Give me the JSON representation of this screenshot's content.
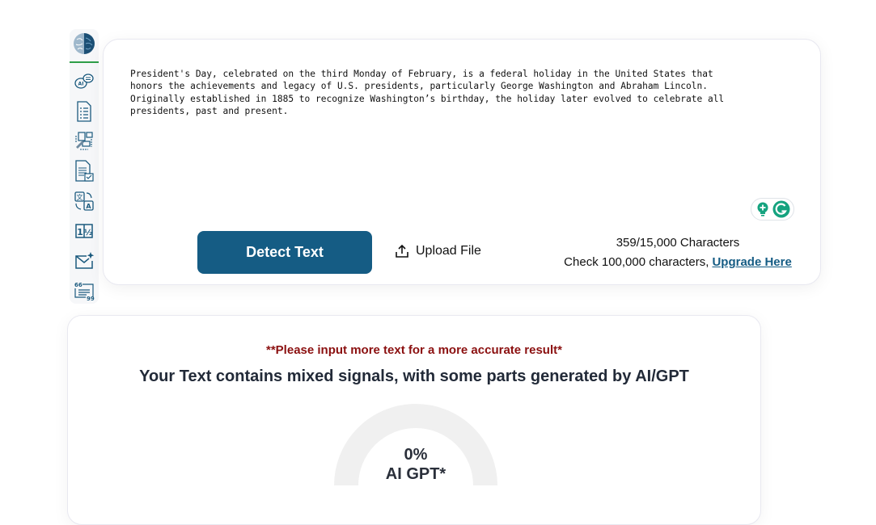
{
  "sidebar": {
    "logo": "brain-logo-icon",
    "items": [
      {
        "name": "ai-chat",
        "icon": "ai-chat-bubbles-icon"
      },
      {
        "name": "document-list",
        "icon": "document-list-icon"
      },
      {
        "name": "rewriter",
        "icon": "edit-workflow-icon"
      },
      {
        "name": "document-check",
        "icon": "document-check-icon"
      },
      {
        "name": "translator",
        "icon": "translate-icon"
      },
      {
        "name": "number-converter",
        "icon": "number-fraction-icon"
      },
      {
        "name": "email-writer",
        "icon": "mail-sparkle-icon"
      },
      {
        "name": "quote-generator",
        "icon": "quote-icon"
      }
    ]
  },
  "input": {
    "text": "President's Day, celebrated on the third Monday of February, is a federal holiday in the United States that\nhonors the achievements and legacy of U.S. presidents, particularly George Washington and Abraham Lincoln.\nOriginally established in 1885 to recognize Washington’s birthday, the holiday later evolved to celebrate all\npresidents, past and present."
  },
  "toolbar": {
    "detect_label": "Detect Text",
    "upload_label": "Upload File",
    "char_count": "359/15,000 Characters",
    "upgrade_prefix": "Check 100,000 characters,",
    "upgrade_link": "Upgrade Here"
  },
  "result": {
    "warning": "**Please input more text for a more accurate result*",
    "verdict": "Your Text contains mixed signals, with some parts generated by AI/GPT",
    "gauge_value_percent": 0,
    "gauge_percent_label": "0%",
    "gauge_caption": "AI GPT*"
  },
  "colors": {
    "primary": "#155c84",
    "warning": "#8b1010",
    "gauge_track": "#f0f0f0",
    "grammarly": "#15a37f"
  }
}
